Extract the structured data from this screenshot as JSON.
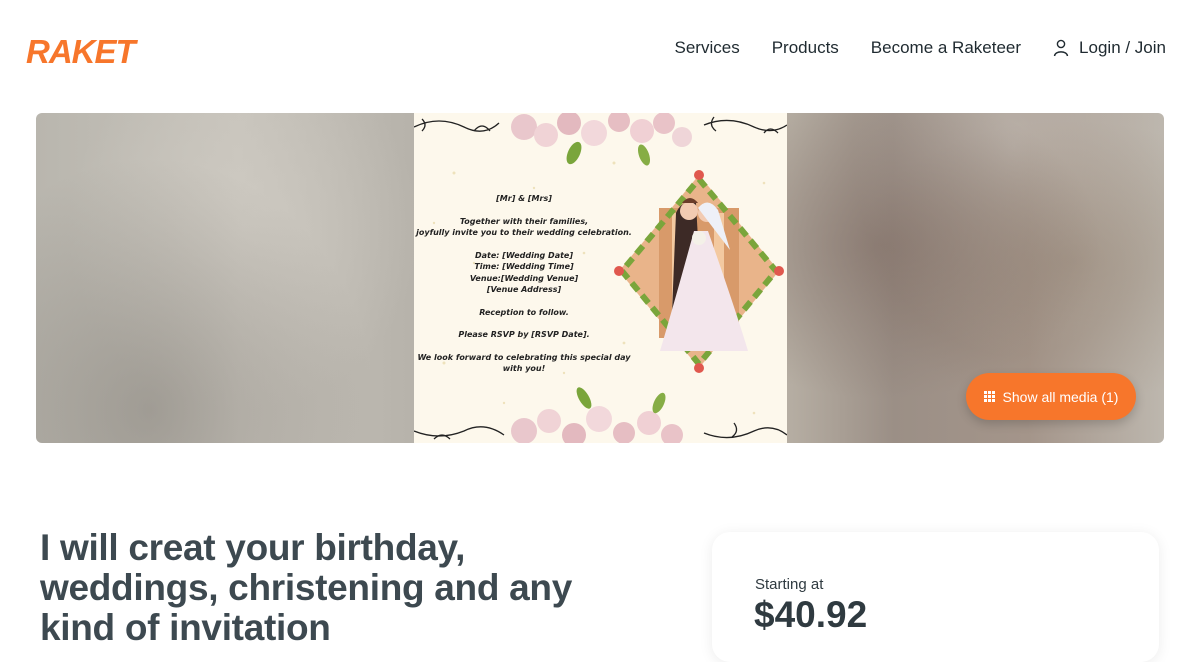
{
  "header": {
    "logo_text": "RAKET",
    "brand_color": "#f7762b",
    "nav": [
      {
        "label": "Services"
      },
      {
        "label": "Products"
      },
      {
        "label": "Become a Raketeer"
      }
    ],
    "login": {
      "icon": "user-icon",
      "label": "Login / Join"
    }
  },
  "gallery": {
    "invitation": {
      "lines_1": [
        "[Mr] & [Mrs]"
      ],
      "lines_2": [
        "Together with their families,",
        "joyfully invite you to their wedding celebration."
      ],
      "lines_3": [
        "Date: [Wedding Date]",
        "Time: [Wedding Time]",
        "Venue:[Wedding Venue]",
        "[Venue Address]"
      ],
      "lines_4": [
        "Reception to follow."
      ],
      "lines_5": [
        "Please RSVP by [RSVP Date]."
      ],
      "lines_6": [
        "We look forward to celebrating this special day",
        "with you!"
      ]
    },
    "show_all_label": "Show all media (1)",
    "show_all_icon": "grid-icon"
  },
  "listing": {
    "title": "I will creat your birthday, weddings, christening and any kind of invitation"
  },
  "pricing": {
    "starting_label": "Starting at",
    "price": "$40.92"
  }
}
